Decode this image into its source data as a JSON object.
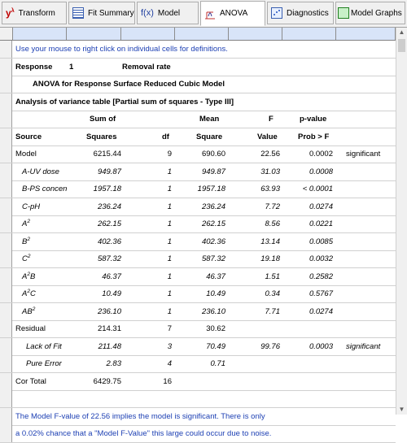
{
  "tabs": [
    {
      "label": "Transform",
      "icon": "y-lambda-icon",
      "icon_text": "yλ"
    },
    {
      "label": "Fit Summary",
      "icon": "fit-summary-icon",
      "icon_text": "▤"
    },
    {
      "label": "Model",
      "icon": "fx-icon",
      "icon_text": "f(x)"
    },
    {
      "label": "ANOVA",
      "icon": "anova-icon",
      "icon_text": "⚖"
    },
    {
      "label": "Diagnostics",
      "icon": "diagnostics-icon",
      "icon_text": "▦"
    },
    {
      "label": "Model Graphs",
      "icon": "model-graphs-icon",
      "icon_text": "▣"
    }
  ],
  "active_tab": "ANOVA",
  "hint": "Use your mouse to right click on individual cells for definitions.",
  "response": {
    "label": "Response",
    "number": "1",
    "name": "Removal rate"
  },
  "anova_title": "ANOVA for Response Surface Reduced Cubic Model",
  "table_title": "Analysis of variance table [Partial sum of squares - Type III]",
  "headers1": {
    "sum": "Sum of",
    "mean": "Mean",
    "f": "F",
    "p": "p-value"
  },
  "headers2": {
    "source": "Source",
    "sum": "Squares",
    "df": "df",
    "mean": "Square",
    "f": "Value",
    "p": "Prob > F"
  },
  "rows": [
    {
      "source": "Model",
      "sum": "6215.44",
      "df": "9",
      "mean": "690.60",
      "f": "22.56",
      "p": "0.0002",
      "note": "significant",
      "italic": false
    },
    {
      "source": "A-UV dose",
      "sum": "949.87",
      "df": "1",
      "mean": "949.87",
      "f": "31.03",
      "p": "0.0008",
      "note": "",
      "italic": true
    },
    {
      "source": "B-PS concen",
      "sum": "1957.18",
      "df": "1",
      "mean": "1957.18",
      "f": "63.93",
      "p": "< 0.0001",
      "note": "",
      "italic": true
    },
    {
      "source": "C-pH",
      "sum": "236.24",
      "df": "1",
      "mean": "236.24",
      "f": "7.72",
      "p": "0.0274",
      "note": "",
      "italic": true
    },
    {
      "source": "A²",
      "sum": "262.15",
      "df": "1",
      "mean": "262.15",
      "f": "8.56",
      "p": "0.0221",
      "note": "",
      "italic": true
    },
    {
      "source": "B²",
      "sum": "402.36",
      "df": "1",
      "mean": "402.36",
      "f": "13.14",
      "p": "0.0085",
      "note": "",
      "italic": true
    },
    {
      "source": "C²",
      "sum": "587.32",
      "df": "1",
      "mean": "587.32",
      "f": "19.18",
      "p": "0.0032",
      "note": "",
      "italic": true
    },
    {
      "source": "A²B",
      "sum": "46.37",
      "df": "1",
      "mean": "46.37",
      "f": "1.51",
      "p": "0.2582",
      "note": "",
      "italic": true
    },
    {
      "source": "A²C",
      "sum": "10.49",
      "df": "1",
      "mean": "10.49",
      "f": "0.34",
      "p": "0.5767",
      "note": "",
      "italic": true
    },
    {
      "source": "AB²",
      "sum": "236.10",
      "df": "1",
      "mean": "236.10",
      "f": "7.71",
      "p": "0.0274",
      "note": "",
      "italic": true
    },
    {
      "source": "Residual",
      "sum": "214.31",
      "df": "7",
      "mean": "30.62",
      "f": "",
      "p": "",
      "note": "",
      "italic": false
    },
    {
      "source": "Lack of Fit",
      "sum": "211.48",
      "df": "3",
      "mean": "70.49",
      "f": "99.76",
      "p": "0.0003",
      "note": "significant",
      "italic": true
    },
    {
      "source": "Pure Error",
      "sum": "2.83",
      "df": "4",
      "mean": "0.71",
      "f": "",
      "p": "",
      "note": "",
      "italic": true
    },
    {
      "source": "Cor Total",
      "sum": "6429.75",
      "df": "16",
      "mean": "",
      "f": "",
      "p": "",
      "note": "",
      "italic": false
    }
  ],
  "footer1": "The Model F-value of 22.56 implies the model is significant.  There is only",
  "footer2": "a 0.02% chance that a \"Model F-Value\" this large could occur due to noise.",
  "colors": {
    "hint_text": "#1c3fb3",
    "header_row": "#d8e4f8"
  }
}
